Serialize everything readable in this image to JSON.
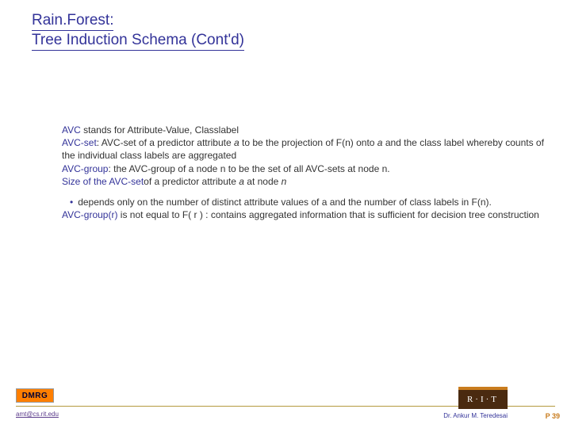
{
  "title": {
    "line1": "Rain.Forest:",
    "line2": "Tree Induction Schema (Cont'd)"
  },
  "body": {
    "avc_kw": "AVC",
    "avc_rest": " stands for Attribute-Value, Classlabel",
    "avcset_kw": "AVC-set",
    "avcset_rest_1": ": AVC-set of a predictor attribute ",
    "avcset_a1": "a",
    "avcset_rest_2": " to be the projection of F(n) onto ",
    "avcset_a2": "a",
    "avcset_rest_3": " and the class label whereby counts of the individual class labels are aggregated",
    "avcgroup_kw": "AVC-group",
    "avcgroup_rest": ": the AVC-group of a node n to be the set of all AVC-sets at node n.",
    "size_kw": "Size of the AVC-set",
    "size_rest_1": "of a predictor attribute ",
    "size_a": "a",
    "size_rest_2": " at node ",
    "size_n": "n",
    "bullet": "depends only on the number of distinct attribute values of a and the number of class labels in F(n).",
    "avcgroup_r_kw": "AVC-group(r)",
    "avcgroup_r_rest": " is not equal to F( r ) : contains aggregated information that is sufficient for decision tree construction"
  },
  "footer": {
    "dmrg": "DMRG",
    "email": "amt@cs.rit.edu",
    "rit": "R·I·T",
    "author": "Dr. Ankur M. Teredesai",
    "pagenum": "P 39"
  }
}
